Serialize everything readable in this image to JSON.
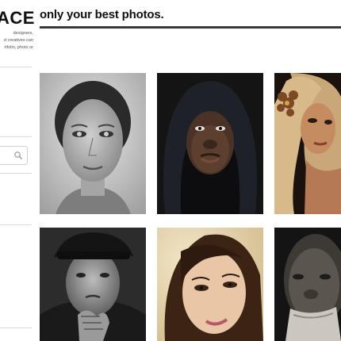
{
  "brand": {
    "logo_text": "ACE",
    "tagline_lines": [
      "designers,",
      "d creatives can",
      "rtfolio, photo or"
    ]
  },
  "header": {
    "title": "only your best photos."
  },
  "search": {
    "icon": "search-icon"
  },
  "gallery": {
    "photos": [
      {
        "name": "photo-woman-freckles",
        "tone": "grayscale"
      },
      {
        "name": "photo-man-hood",
        "tone": "color"
      },
      {
        "name": "photo-woman-blonde-flower",
        "tone": "color"
      },
      {
        "name": "photo-old-man-cap",
        "tone": "grayscale"
      },
      {
        "name": "photo-woman-brunette",
        "tone": "color"
      },
      {
        "name": "photo-elder-man",
        "tone": "dark"
      }
    ]
  },
  "colors": {
    "heading_rule": "#3a3a3a",
    "divider": "#d9d9d9"
  }
}
